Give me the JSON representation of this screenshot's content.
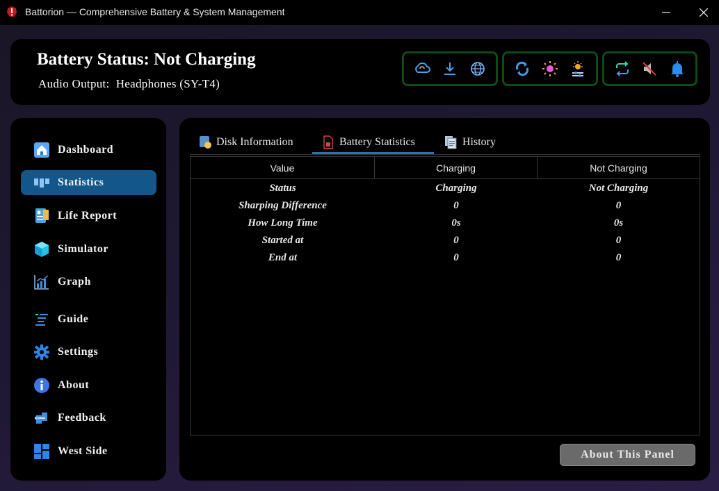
{
  "window": {
    "title": "Battorion — Comprehensive Battery & System Management",
    "minimize_glyph": "—",
    "close_glyph": "✕"
  },
  "header": {
    "status_title": "Battery Status: Not Charging",
    "audio_label": "Audio Output:",
    "audio_value": "Headphones (SY-T4)",
    "icon_groups": [
      [
        "cloud-sync-icon",
        "download-icon",
        "globe-icon"
      ],
      [
        "sync-icon",
        "brightness-icon",
        "display-brightness-icon"
      ],
      [
        "refresh-icon",
        "mute-icon",
        "bell-icon"
      ]
    ],
    "group_border_color": "#0f4a17"
  },
  "sidebar": {
    "items": [
      {
        "label": "Dashboard",
        "icon": "home-icon",
        "active": false
      },
      {
        "label": "Statistics",
        "icon": "statistics-icon",
        "active": true
      },
      {
        "label": "Life Report",
        "icon": "report-icon",
        "active": false
      },
      {
        "label": "Simulator",
        "icon": "cube-icon",
        "active": false
      },
      {
        "label": "Graph",
        "icon": "graph-icon",
        "active": false
      },
      {
        "label": "Guide",
        "icon": "guide-icon",
        "active": false
      },
      {
        "label": "Settings",
        "icon": "gear-icon",
        "active": false
      },
      {
        "label": "About",
        "icon": "info-icon",
        "active": false
      },
      {
        "label": "Feedback",
        "icon": "feedback-icon",
        "active": false
      },
      {
        "label": "West Side",
        "icon": "grid-icon",
        "active": false
      }
    ],
    "active_color": "#13578a"
  },
  "main": {
    "tabs": [
      {
        "label": "Disk Information",
        "icon": "disk-icon",
        "active": false
      },
      {
        "label": "Battery Statistics",
        "icon": "battery-doc-icon",
        "active": true
      },
      {
        "label": "History",
        "icon": "history-icon",
        "active": false
      }
    ],
    "table": {
      "headers": [
        "Value",
        "Charging",
        "Not Charging"
      ],
      "rows": [
        [
          "Status",
          "Charging",
          "Not Charging"
        ],
        [
          "Sharping Difference",
          "0",
          "0"
        ],
        [
          "How Long Time",
          "0s",
          "0s"
        ],
        [
          "Started at",
          "0",
          "0"
        ],
        [
          "End at",
          "0",
          "0"
        ]
      ]
    },
    "about_button": "About This Panel"
  }
}
